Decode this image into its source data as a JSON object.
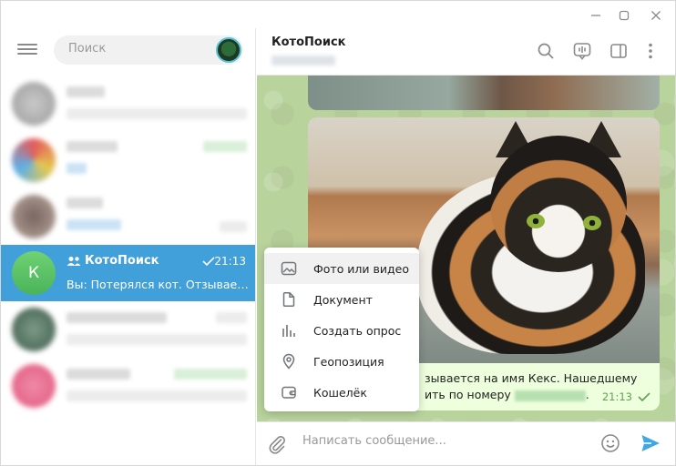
{
  "search": {
    "placeholder": "Поиск"
  },
  "chats": {
    "active": {
      "avatar_letter": "К",
      "name": "КотоПоиск",
      "time": "21:13",
      "preview": "Вы: Потерялся кот. Отзываетс..."
    }
  },
  "header": {
    "title": "КотоПоиск"
  },
  "message": {
    "text_line1": "зывается на имя Кекс. Нашедшему",
    "text_line2": "ить по номеру",
    "text_line2_end": ".",
    "time": "21:13"
  },
  "attach_menu": {
    "items": [
      {
        "label": "Фото или видео",
        "icon": "photo-icon"
      },
      {
        "label": "Документ",
        "icon": "document-icon"
      },
      {
        "label": "Создать опрос",
        "icon": "poll-icon"
      },
      {
        "label": "Геопозиция",
        "icon": "location-icon"
      },
      {
        "label": "Кошелёк",
        "icon": "wallet-icon"
      }
    ]
  },
  "composer": {
    "placeholder": "Написать сообщение..."
  },
  "colors": {
    "accent": "#419fd9",
    "send": "#40a7e3",
    "bubble": "#eeffde",
    "wallpaper": "#b9d39d"
  }
}
